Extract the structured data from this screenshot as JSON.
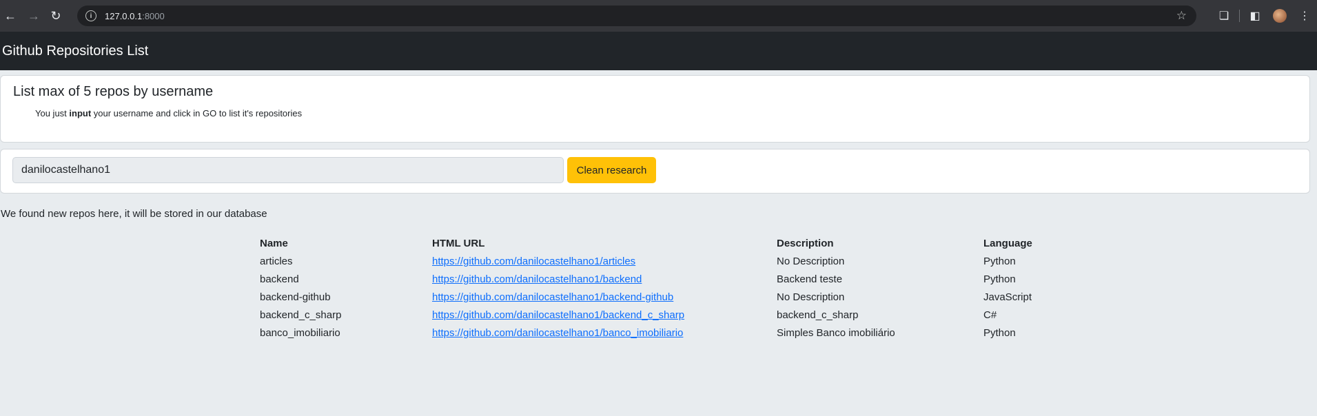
{
  "browser": {
    "url_host": "127.0.0.1",
    "url_port": ":8000"
  },
  "navbar": {
    "brand": "Github Repositories List"
  },
  "hero": {
    "title": "List max of 5 repos by username",
    "text_before": "You just ",
    "text_bold": "input",
    "text_after": " your username and click in GO to list it's repositories"
  },
  "search": {
    "value": "danilocastelhano1",
    "clean_label": "Clean research"
  },
  "message": "We found new repos here, it will be stored in our database",
  "table": {
    "headers": [
      "Name",
      "HTML URL",
      "Description",
      "Language"
    ],
    "rows": [
      {
        "name": "articles",
        "url": "https://github.com/danilocastelhano1/articles",
        "description": "No Description",
        "language": "Python"
      },
      {
        "name": "backend",
        "url": "https://github.com/danilocastelhano1/backend",
        "description": "Backend teste",
        "language": "Python"
      },
      {
        "name": "backend-github",
        "url": "https://github.com/danilocastelhano1/backend-github",
        "description": "No Description",
        "language": "JavaScript"
      },
      {
        "name": "backend_c_sharp",
        "url": "https://github.com/danilocastelhano1/backend_c_sharp",
        "description": "backend_c_sharp",
        "language": "C#"
      },
      {
        "name": "banco_imobiliario",
        "url": "https://github.com/danilocastelhano1/banco_imobiliario",
        "description": "Simples Banco imobiliário",
        "language": "Python"
      }
    ]
  }
}
